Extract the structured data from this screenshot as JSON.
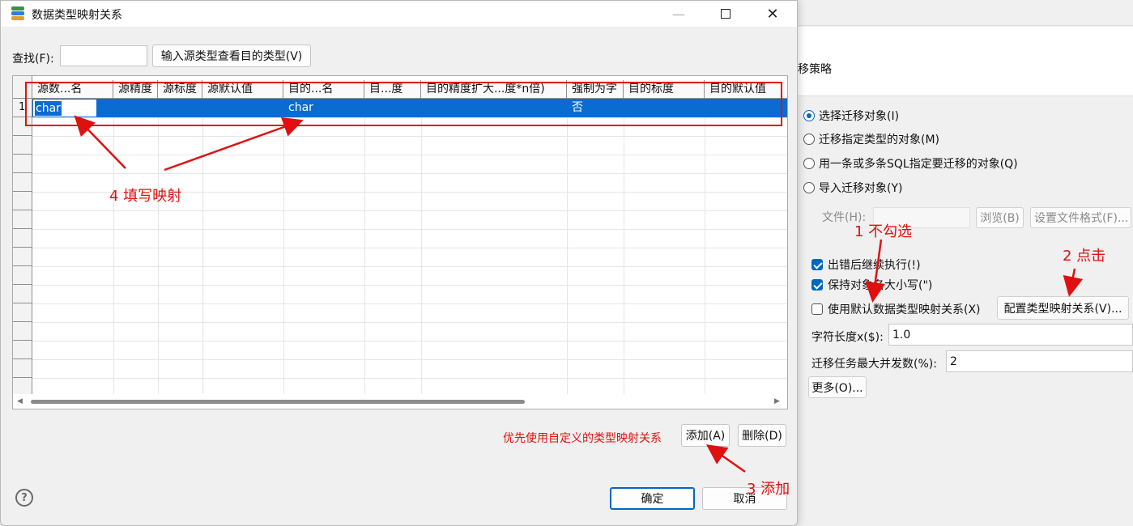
{
  "dialog": {
    "title": "数据类型映射关系",
    "find_label": "查找(F):",
    "find_value": "",
    "lookup_button": "输入源类型查看目的类型(V)",
    "grid": {
      "columns": [
        "源数...名",
        "源精度",
        "源标度",
        "源默认值",
        "目的...名",
        "目...度",
        "目的精度扩大...度*n倍)",
        "强制为字",
        "目的标度",
        "目的默认值"
      ],
      "rows": [
        {
          "index": "1",
          "cells": [
            "char",
            "",
            "",
            "",
            "char",
            "",
            "",
            "否",
            "",
            ""
          ]
        }
      ],
      "empty_row_count": 15
    },
    "hint_text": "优先使用自定义的类型映射关系",
    "add_button": "添加(A)",
    "delete_button": "删除(D)",
    "ok_button": "确定",
    "cancel_button": "取消",
    "help_icon": "question-icon"
  },
  "background_window": {
    "heading": "移策略",
    "radios": [
      {
        "label": "选择迁移对象(I)",
        "checked": true
      },
      {
        "label": "迁移指定类型的对象(M)",
        "checked": false
      },
      {
        "label": "用一条或多条SQL指定要迁移的对象(Q)",
        "checked": false
      },
      {
        "label": "导入迁移对象(Y)",
        "checked": false
      }
    ],
    "file_label": "文件(H):",
    "browse_button": "浏览(B)",
    "file_format_button": "设置文件格式(F)...",
    "checkboxes": [
      {
        "label": "出错后继续执行(!)",
        "checked": true
      },
      {
        "label": "保持对象名大小写(\")",
        "checked": true
      },
      {
        "label": "使用默认数据类型映射关系(X)",
        "checked": false
      }
    ],
    "config_mapping_button": "配置类型映射关系(V)...",
    "char_length_label": "字符长度x($):",
    "char_length_value": "1.0",
    "max_concurrency_label": "迁移任务最大并发数(%):",
    "max_concurrency_value": "2",
    "more_button": "更多(O)..."
  },
  "annotations": {
    "step1": "1 不勾选",
    "step2": "2 点击",
    "step3": "3 添加",
    "step4": "4 填写映射",
    "color": "#e01010"
  },
  "colors": {
    "selection": "#0a6cd0",
    "accent": "#0067c0"
  }
}
